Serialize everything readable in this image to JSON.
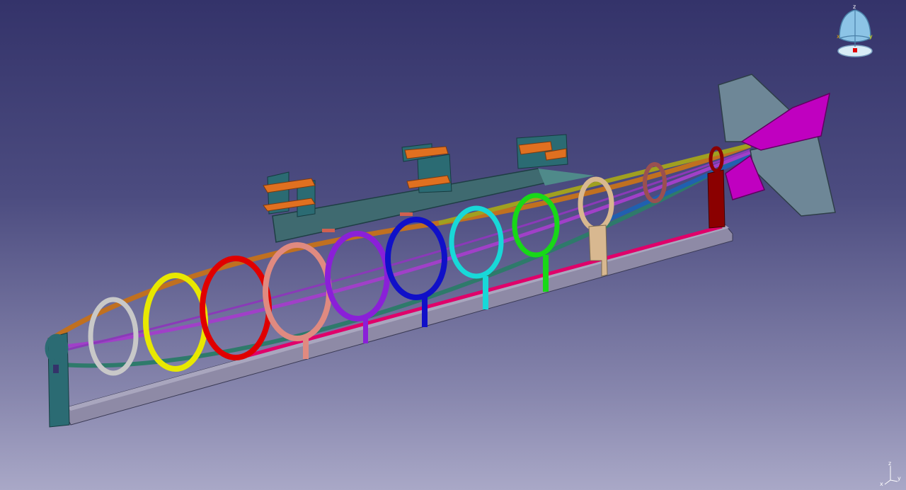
{
  "colors": {
    "bg_top": "#34336a",
    "bg_bottom": "#a9a8c7",
    "rings": [
      "#2b6b73",
      "#c8c8c8",
      "#e8e800",
      "#e00000",
      "#e08a80",
      "#8a20d8",
      "#1010c8",
      "#18d8d8",
      "#18d818",
      "#d8b890",
      "#9a5050",
      "#8b0000"
    ],
    "fin_upper": "#6e8797",
    "fin_lower": "#6e8797",
    "rudder": "#c000c0",
    "rail": "#8e8aa6",
    "mount": "#e07020",
    "bracket": "#2b6b73"
  },
  "compass": {
    "icon": "view-compass-icon",
    "axis_z": "z",
    "axis_x": "x",
    "axis_y": "y"
  },
  "mini_axis": {
    "icon": "mini-axis-triad-icon",
    "z": "z",
    "x": "x",
    "y": "y"
  }
}
